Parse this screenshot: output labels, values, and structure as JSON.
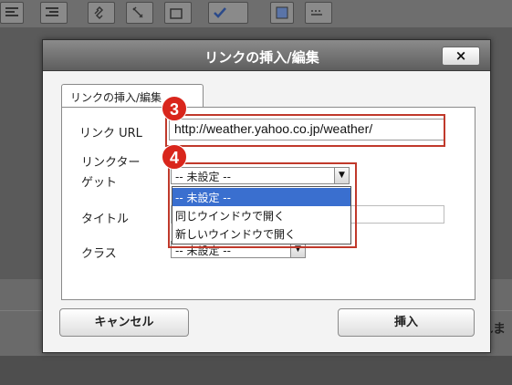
{
  "background": {
    "toolbar_icons": [
      "align-left-icon",
      "align-right-icon",
      "link-icon",
      "unlink-icon",
      "anchor-icon",
      "checkmark-icon",
      "image-icon",
      "keyboard-icon"
    ],
    "partial_text": "れま"
  },
  "dialog": {
    "title": "リンクの挿入/編集",
    "close_label": "×",
    "tab_label": "リンクの挿入/編集",
    "url_label": "リンク URL",
    "url_value": "http://weather.yahoo.co.jp/weather/",
    "target_label_line1": "リンクター",
    "target_label_line2": "ゲット",
    "target_selected": "-- 未設定 --",
    "target_options": [
      "-- 未設定 --",
      "同じウインドウで開く",
      "新しいウインドウで開く"
    ],
    "title_label": "タイトル",
    "class_label": "クラス",
    "class_selected": "-- 未設定 --",
    "cancel_label": "キャンセル",
    "insert_label": "挿入"
  },
  "annotations": {
    "badge_url": "3",
    "badge_target": "4"
  },
  "colors": {
    "highlight": "#c0392b",
    "badge": "#d9261c",
    "selected_option": "#3a6fcf",
    "titlebar": "#6e6e6e"
  }
}
